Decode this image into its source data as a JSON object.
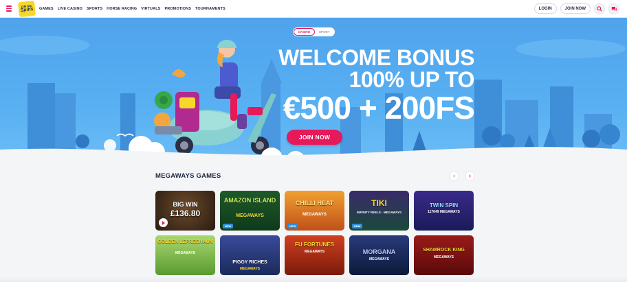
{
  "header": {
    "logo_line1": "OH My",
    "logo_line2": "Spins",
    "nav": [
      "GAMES",
      "LIVE CASINO",
      "SPORTS",
      "HORSE RACING",
      "VIRTUALS",
      "PROMOTIONS",
      "TOURNAMENTS"
    ],
    "login_label": "LOGIN",
    "join_label": "JOIN NOW"
  },
  "hero": {
    "toggle": {
      "casino": "CASINO",
      "sport": "SPORT",
      "active": "CASINO"
    },
    "bonus_line1": "WELCOME BONUS",
    "bonus_line2": "100% UP TO",
    "bonus_line3": "€500 + 200FS",
    "join_label": "JOIN NOW"
  },
  "section": {
    "title": "MEGAWAYS GAMES",
    "prev_icon": "chevron-left-icon",
    "next_icon": "chevron-right-icon"
  },
  "games": [
    {
      "name": "BIG WIN",
      "sub": "£136.80",
      "badge": "",
      "has_play": true
    },
    {
      "name": "AMAZON ISLAND",
      "sub": "MEGAWAYS",
      "badge": "NEW",
      "has_play": false
    },
    {
      "name": "CHILLI HEAT",
      "sub": "MEGAWAYS",
      "badge": "NEW",
      "has_play": false
    },
    {
      "name": "TIKI",
      "sub": "INFINITY REELS · MEGAWAYS",
      "badge": "NEW",
      "has_play": false
    },
    {
      "name": "TWIN SPIN",
      "sub": "117649 MEGAWAYS",
      "badge": "",
      "has_play": false
    },
    {
      "name": "GOLDEN LEPRECHAUN",
      "sub": "MEGAWAYS",
      "badge": "",
      "has_play": false
    },
    {
      "name": "PIGGY RICHES",
      "sub": "MEGAWAYS",
      "badge": "",
      "has_play": false
    },
    {
      "name": "FU FORTUNES",
      "sub": "MEGAWAYS",
      "badge": "",
      "has_play": false
    },
    {
      "name": "MORGANA",
      "sub": "MEGAWAYS",
      "badge": "",
      "has_play": false
    },
    {
      "name": "SHAMROCK KING",
      "sub": "MEGAWAYS",
      "badge": "",
      "has_play": false
    }
  ],
  "colors": {
    "accent": "#e6195a",
    "sky": "#58b0f2",
    "navy": "#1f2742"
  }
}
